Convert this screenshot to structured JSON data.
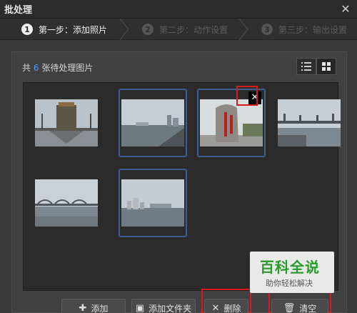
{
  "window": {
    "title": "批处理",
    "close_icon": "close-icon"
  },
  "steps": [
    {
      "num": "1",
      "label": "第一步：添加照片",
      "state": "active"
    },
    {
      "num": "2",
      "label": "第二步：动作设置",
      "state": "inactive"
    },
    {
      "num": "3",
      "label": "第三步：输出设置",
      "state": "inactive"
    }
  ],
  "panel": {
    "count_prefix": "共",
    "count": "6",
    "count_suffix": "张待处理图片",
    "view_modes": [
      "list-view-icon",
      "grid-view-icon"
    ],
    "active_view": "grid"
  },
  "thumbnails": [
    {
      "name": "bridge-gate-photo",
      "selected": false
    },
    {
      "name": "river-harbor-photo",
      "selected": true
    },
    {
      "name": "stone-monument-photo",
      "selected": true,
      "has_delete": true
    },
    {
      "name": "river-bridge-photo",
      "selected": false
    },
    {
      "name": "long-bridge-photo",
      "selected": false
    },
    {
      "name": "city-shore-photo",
      "selected": true
    }
  ],
  "buttons": {
    "add": "添加",
    "add_folder": "添加文件夹",
    "delete": "删除",
    "clear": "清空"
  },
  "watermark": {
    "title": "百科全说",
    "subtitle": "助你轻松解决"
  },
  "colors": {
    "accent": "#4aa3ff",
    "highlight": "#d41c1c",
    "selection": "#3d5f8f"
  }
}
